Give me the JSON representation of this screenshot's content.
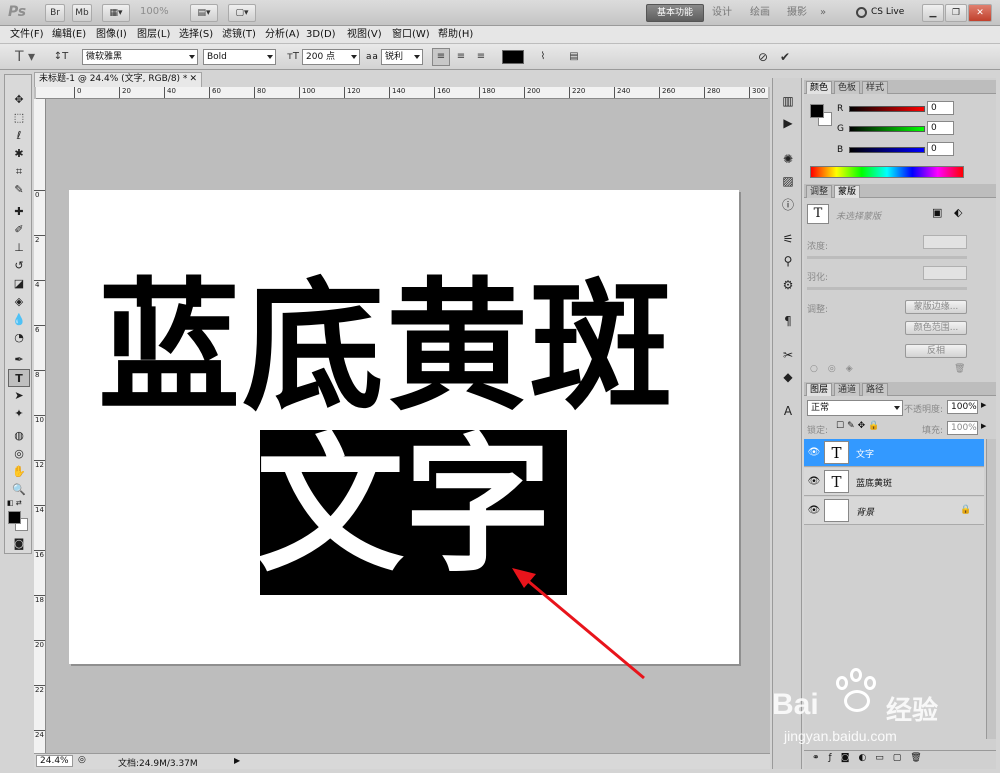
{
  "app": {
    "logo": "Ps",
    "zoom": "100%",
    "workspaces": [
      "基本功能",
      "设计",
      "绘画",
      "摄影"
    ],
    "active_workspace": "基本功能",
    "cs_live": "CS Live"
  },
  "menu": [
    "文件(F)",
    "编辑(E)",
    "图像(I)",
    "图层(L)",
    "选择(S)",
    "滤镜(T)",
    "分析(A)",
    "3D(D)",
    "视图(V)",
    "窗口(W)",
    "帮助(H)"
  ],
  "options": {
    "font_family": "微软雅黑",
    "font_style": "Bold",
    "font_size": "200 点",
    "aa_label": "a a",
    "antialias": "锐利"
  },
  "document": {
    "tab_title": "未标题-1 @ 24.4% (文字, RGB/8) *",
    "ruler_top": [
      "0",
      "20",
      "40",
      "60",
      "80",
      "100",
      "120",
      "140",
      "160",
      "180",
      "200",
      "220",
      "240",
      "260",
      "280",
      "300"
    ],
    "ruler_left": [
      "0",
      "2",
      "4",
      "6",
      "8",
      "10",
      "12",
      "14",
      "16",
      "18",
      "20",
      "22",
      "24"
    ],
    "text_line1": "蓝底黄斑",
    "text_line2": "文字"
  },
  "status": {
    "zoom": "24.4%",
    "doc_info": "文档:24.9M/3.37M"
  },
  "color_panel": {
    "tabs": [
      "颜色",
      "色板",
      "样式"
    ],
    "channels": [
      {
        "label": "R",
        "value": "0"
      },
      {
        "label": "G",
        "value": "0"
      },
      {
        "label": "B",
        "value": "0"
      }
    ]
  },
  "masks_panel": {
    "tabs": [
      "调整",
      "蒙版"
    ],
    "title": "未选择蒙版",
    "density": "浓度:",
    "feather": "羽化:",
    "refine": "调整:",
    "btn_edge": "蒙版边缘...",
    "btn_range": "颜色范围...",
    "btn_invert": "反相"
  },
  "layers_panel": {
    "tabs": [
      "图层",
      "通道",
      "路径"
    ],
    "blend_mode": "正常",
    "opacity_label": "不透明度:",
    "opacity": "100%",
    "lock_label": "锁定:",
    "fill_label": "填充:",
    "fill": "100%",
    "layers": [
      {
        "name": "文字",
        "type": "text"
      },
      {
        "name": "蓝底黄斑",
        "type": "text"
      },
      {
        "name": "背景",
        "type": "background"
      }
    ]
  },
  "watermark": {
    "brand": "Bai",
    "brand2": "经验",
    "url": "jingyan.baidu.com"
  }
}
